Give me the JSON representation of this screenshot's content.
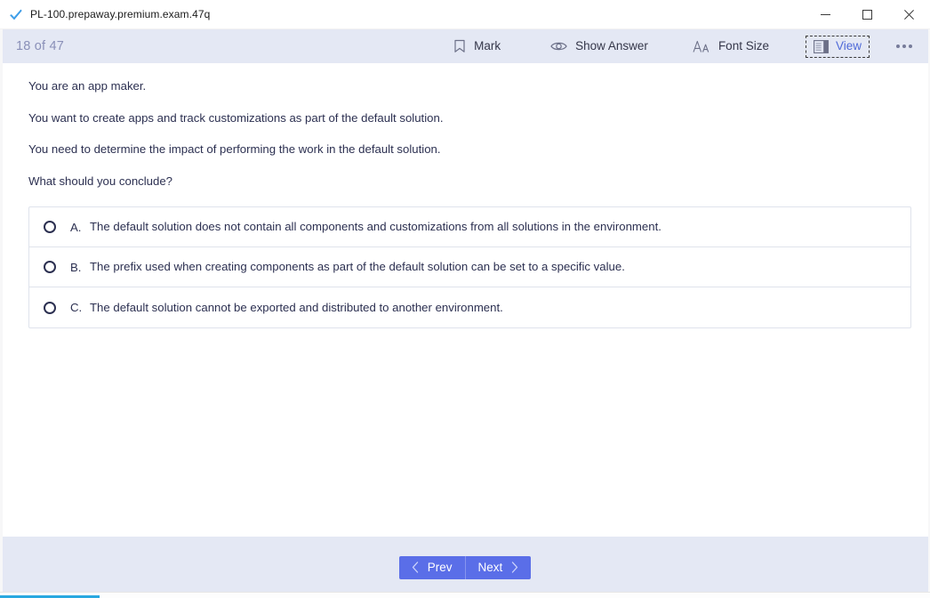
{
  "window": {
    "title": "PL-100.prepaway.premium.exam.47q",
    "app_icon": "blue-checkmark-icon",
    "controls": {
      "minimize": "minimize-icon",
      "maximize": "maximize-icon",
      "close": "close-icon"
    }
  },
  "toolbar": {
    "counter": "18 of 47",
    "mark_label": "Mark",
    "mark_icon": "bookmark-icon",
    "show_answer_label": "Show Answer",
    "show_answer_icon": "eye-icon",
    "font_size_label": "Font Size",
    "font_size_icon": "font-size-icon",
    "view_label": "View",
    "view_icon": "layout-pane-icon",
    "more_icon": "ellipsis-icon"
  },
  "question": {
    "stem": [
      "You are an app maker.",
      "You want to create apps and track customizations as part of the default solution.",
      "You need to determine the impact of performing the work in the default solution.",
      "What should you conclude?"
    ],
    "options": [
      {
        "letter": "A.",
        "text": "The default solution does not contain all components and customizations from all solutions in the environment.",
        "selected": false
      },
      {
        "letter": "B.",
        "text": "The prefix used when creating components as part of the default solution can be set to a specific value.",
        "selected": false
      },
      {
        "letter": "C.",
        "text": "The default solution cannot be exported and distributed to another environment.",
        "selected": false
      }
    ]
  },
  "footer": {
    "prev_label": "Prev",
    "next_label": "Next",
    "prev_icon": "chevron-left-icon",
    "next_icon": "chevron-right-icon"
  },
  "colors": {
    "toolbar_bg": "#e4e8f4",
    "accent_blue": "#5a6ee8",
    "link_blue": "#4f6ad8",
    "counter_text": "#8a90b8",
    "body_text": "#2c3051",
    "option_border": "#dfe3ec"
  }
}
